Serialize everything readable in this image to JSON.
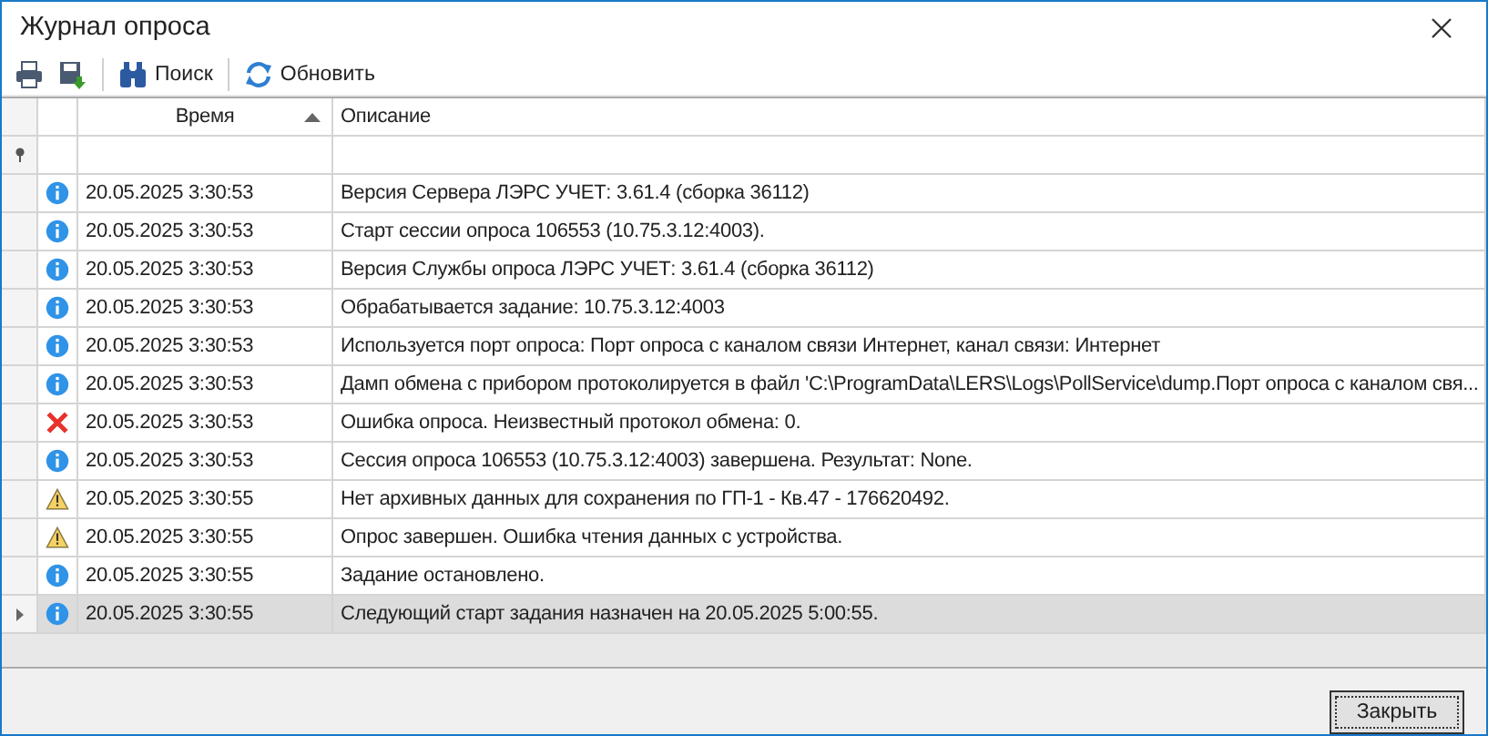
{
  "window": {
    "title": "Журнал опроса"
  },
  "toolbar": [
    {
      "kind": "print"
    },
    {
      "kind": "export"
    },
    {
      "kind": "search",
      "label": "Поиск"
    },
    {
      "kind": "refresh",
      "label": "Обновить"
    }
  ],
  "table": {
    "columns": [
      {
        "label": "Время",
        "sorted": true
      },
      {
        "label": "Описание",
        "sorted": false
      }
    ],
    "rows": [
      {
        "kind": "info",
        "time": "20.05.2025 3:30:53",
        "text": "Версия Сервера ЛЭРС УЧЕТ: 3.61.4 (сборка 36112)",
        "selected": false
      },
      {
        "kind": "info",
        "time": "20.05.2025 3:30:53",
        "text": "Старт сессии опроса 106553 (10.75.3.12:4003).",
        "selected": false
      },
      {
        "kind": "info",
        "time": "20.05.2025 3:30:53",
        "text": "Версия Службы опроса ЛЭРС УЧЕТ: 3.61.4 (сборка 36112)",
        "selected": false
      },
      {
        "kind": "info",
        "time": "20.05.2025 3:30:53",
        "text": "Обрабатывается задание: 10.75.3.12:4003",
        "selected": false
      },
      {
        "kind": "info",
        "time": "20.05.2025 3:30:53",
        "text": "Используется порт опроса: Порт опроса с каналом связи Интернет, канал связи: Интернет",
        "selected": false
      },
      {
        "kind": "info",
        "time": "20.05.2025 3:30:53",
        "text": "Дамп обмена с прибором протоколируется в файл 'C:\\ProgramData\\LERS\\Logs\\PollService\\dump.Порт опроса с каналом свя...",
        "selected": false
      },
      {
        "kind": "error",
        "time": "20.05.2025 3:30:53",
        "text": "Ошибка опроса. Неизвестный протокол обмена: 0.",
        "selected": false
      },
      {
        "kind": "info",
        "time": "20.05.2025 3:30:53",
        "text": "Сессия опроса 106553 (10.75.3.12:4003) завершена. Результат: None.",
        "selected": false
      },
      {
        "kind": "warning",
        "time": "20.05.2025 3:30:55",
        "text": "Нет архивных данных для сохранения по ГП-1 - Кв.47 - 176620492.",
        "selected": false
      },
      {
        "kind": "warning",
        "time": "20.05.2025 3:30:55",
        "text": "Опрос завершен. Ошибка чтения данных с устройства.",
        "selected": false
      },
      {
        "kind": "info",
        "time": "20.05.2025 3:30:55",
        "text": "Задание остановлено.",
        "selected": false
      },
      {
        "kind": "info",
        "time": "20.05.2025 3:30:55",
        "text": "Следующий старт задания назначен на 20.05.2025 5:00:55.",
        "selected": true
      }
    ]
  },
  "buttons": [
    {
      "label": "Закрыть"
    }
  ]
}
